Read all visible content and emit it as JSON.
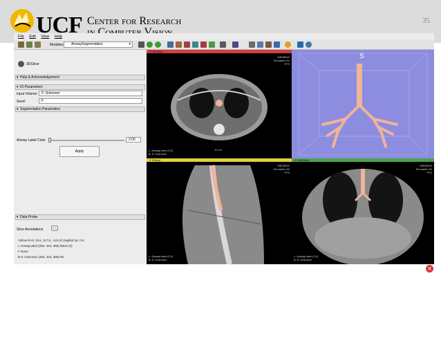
{
  "slide": {
    "logo_text": "UCF",
    "subtitle_line1": "Center for Research",
    "subtitle_line2": "in Computer Vision",
    "page_number": "35"
  },
  "menu": [
    "File",
    "Edit",
    "View",
    "Help"
  ],
  "toolbar": {
    "modules_label": "Modules:",
    "module_value": "AirwaySegmentation"
  },
  "panel": {
    "logo_label": "3DSlicer",
    "sections": {
      "help": "Help & Acknowledgement",
      "io": "IO Parameters",
      "seg": "Segmentation Parameters",
      "probe": "Data Probe"
    },
    "input_volume_label": "Input Volume:",
    "input_volume_value": "5: Unknown",
    "seed_label": "Seed:",
    "seed_value": "F",
    "airway_color_label": "Airway Label Color",
    "airway_color_value": "2.00",
    "apply_label": "Apply",
    "slice_annotations_label": "Slice Annotations",
    "probe_lines": [
      "Yellow  RAS: (9.5, 117.5, -123.4)  Sagittal  Sp: 0.6",
      "L  AirwayLabel  (255, 343, 368)  Black (0)",
      "F  None",
      "B  5: Unknown  (255, 343, 368)  59"
    ]
  },
  "viewers": {
    "axial": {
      "bar": "R  -60.0mm",
      "top_right": [
        "SIEMENS",
        "Sensation 64",
        "FFS"
      ],
      "bottom_left": [
        "L: AirwayLabel (0.0)",
        "B: 5: Unknown"
      ],
      "scale": "10 cm"
    },
    "threed": {
      "bar": "",
      "label": "S"
    },
    "sagittal": {
      "bar": "Y  9.5mm",
      "top_right": [
        "SIEMENS",
        "Sensation 64",
        "FFS"
      ],
      "bottom_left": [
        "L: AirwayLabel (0.0)",
        "B: 5: Unknown"
      ]
    },
    "coronal": {
      "bar": "G  150.0mm",
      "top_right": [
        "SIEMENS",
        "Sensation 64",
        "FFS"
      ],
      "bottom_left": [
        "L: AirwayLabel (0.0)",
        "B: 5: Unknown"
      ]
    }
  },
  "colors": {
    "axial_bar": "#d04040",
    "sagittal_bar": "#e0d040",
    "coronal_bar": "#50a050",
    "airway": "#f0b49a",
    "threed_bg": "#8d8de0"
  }
}
